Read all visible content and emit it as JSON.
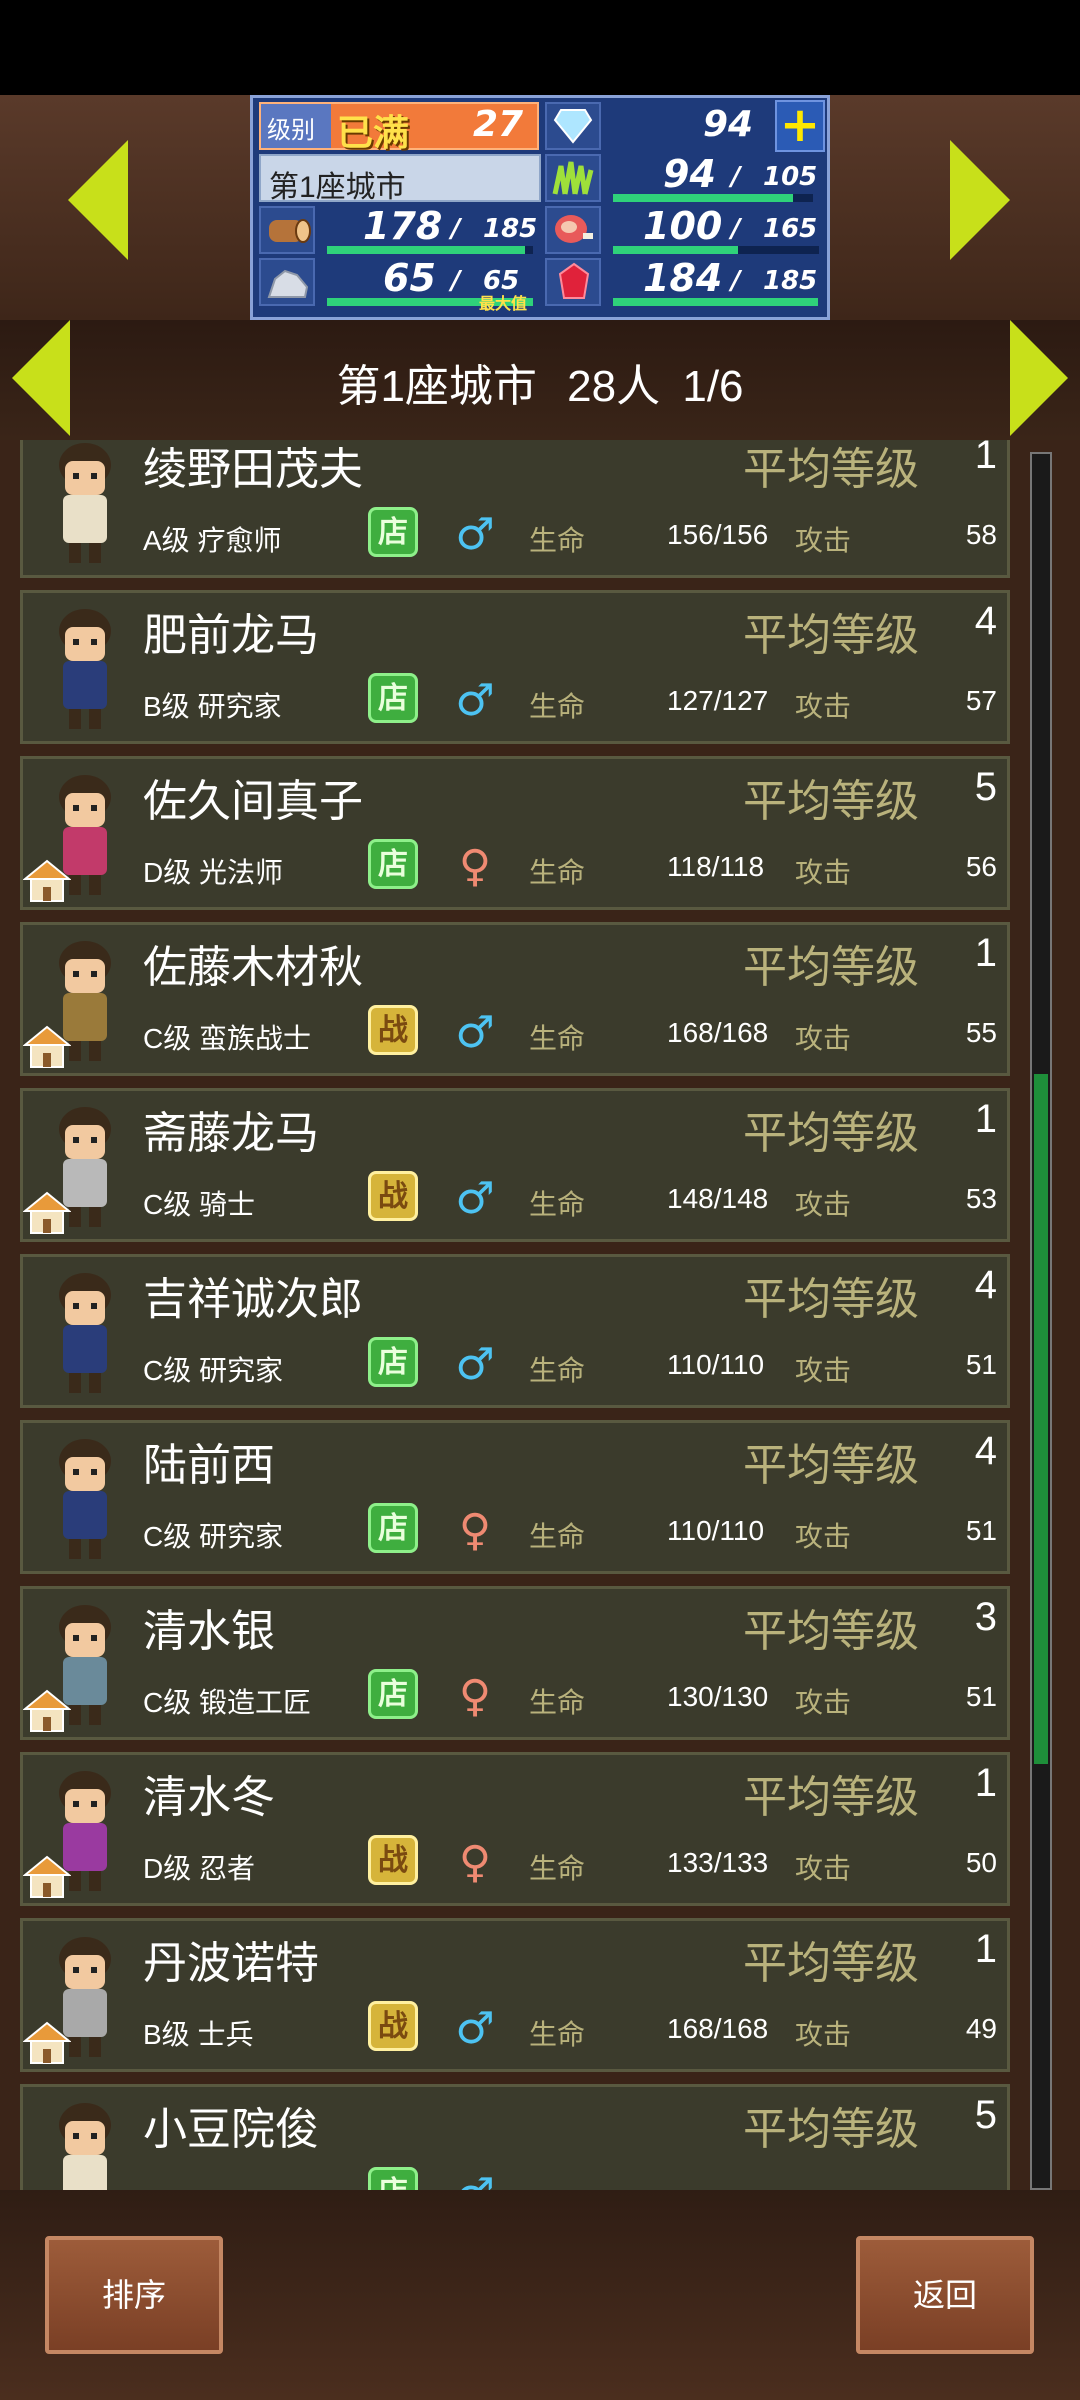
{
  "stats": {
    "level_label": "级别",
    "level_status": "已满",
    "level_value": "27",
    "gems": "94",
    "city_name": "第1座城市",
    "food": {
      "current": "94",
      "max": "105",
      "fill": 0.895
    },
    "wood": {
      "current": "178",
      "max": "185",
      "fill": 0.962
    },
    "meat": {
      "current": "100",
      "max": "165",
      "fill": 0.606
    },
    "stone": {
      "current": "65",
      "max": "65",
      "max_note": "最大值",
      "fill": 1.0
    },
    "ruby": {
      "current": "184",
      "max": "185",
      "fill": 0.995
    },
    "plus_symbol": "+",
    "slash": "/"
  },
  "header": {
    "title": "第1座城市",
    "count": "28人",
    "page": "1/6"
  },
  "labels": {
    "avg_level": "平均等级",
    "hp": "生命",
    "attack": "攻击",
    "shop_badge": "店",
    "battle_badge": "战"
  },
  "residents": [
    {
      "name": "绫野田茂夫",
      "class": "A级 疗愈师",
      "badge": "shop",
      "gender": "male",
      "level": "1",
      "hp": "156/156",
      "attack": "58",
      "house": false,
      "color": "#e9e0c8"
    },
    {
      "name": "肥前龙马",
      "class": "B级 研究家",
      "badge": "shop",
      "gender": "male",
      "level": "4",
      "hp": "127/127",
      "attack": "57",
      "house": false,
      "color": "#2a3d7a"
    },
    {
      "name": "佐久间真子",
      "class": "D级 光法师",
      "badge": "shop",
      "gender": "female",
      "level": "5",
      "hp": "118/118",
      "attack": "56",
      "house": true,
      "color": "#c23a6a"
    },
    {
      "name": "佐藤木材秋",
      "class": "C级 蛮族战士",
      "badge": "battle",
      "gender": "male",
      "level": "1",
      "hp": "168/168",
      "attack": "55",
      "house": true,
      "color": "#9a7a3a"
    },
    {
      "name": "斋藤龙马",
      "class": "C级 骑士",
      "badge": "battle",
      "gender": "male",
      "level": "1",
      "hp": "148/148",
      "attack": "53",
      "house": true,
      "color": "#b9b9b9"
    },
    {
      "name": "吉祥诚次郎",
      "class": "C级 研究家",
      "badge": "shop",
      "gender": "male",
      "level": "4",
      "hp": "110/110",
      "attack": "51",
      "house": false,
      "color": "#2a3d7a"
    },
    {
      "name": "陆前西",
      "class": "C级 研究家",
      "badge": "shop",
      "gender": "female",
      "level": "4",
      "hp": "110/110",
      "attack": "51",
      "house": false,
      "color": "#2a3d7a"
    },
    {
      "name": "清水银",
      "class": "C级 锻造工匠",
      "badge": "shop",
      "gender": "female",
      "level": "3",
      "hp": "130/130",
      "attack": "51",
      "house": true,
      "color": "#6a8a9a"
    },
    {
      "name": "清水冬",
      "class": "D级 忍者",
      "badge": "battle",
      "gender": "female",
      "level": "1",
      "hp": "133/133",
      "attack": "50",
      "house": true,
      "color": "#9a3aa0"
    },
    {
      "name": "丹波诺特",
      "class": "B级 士兵",
      "badge": "battle",
      "gender": "male",
      "level": "1",
      "hp": "168/168",
      "attack": "49",
      "house": true,
      "color": "#a9a9a9"
    },
    {
      "name": "小豆院俊",
      "class": "",
      "badge": "shop",
      "gender": "male",
      "level": "5",
      "hp": "",
      "attack": "",
      "house": false,
      "color": "#e9e0c8"
    }
  ],
  "footer": {
    "sort_label": "排序",
    "back_label": "返回"
  },
  "colors": {
    "arrow": "#c8e01a",
    "bar": "#2fd27a",
    "panel": "#1e3a7a",
    "row_bg": "#3b3b2c",
    "label_gold": "#b9b27c"
  }
}
